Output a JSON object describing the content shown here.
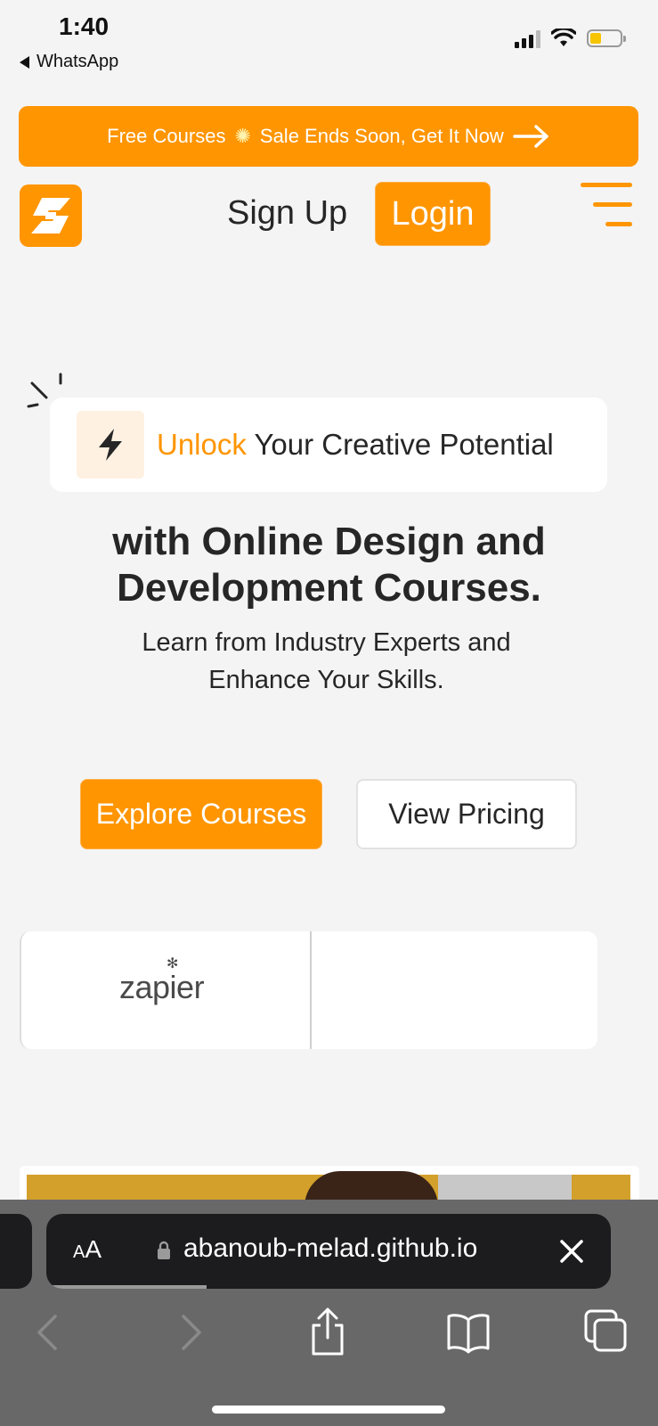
{
  "status_bar": {
    "time": "1:40",
    "back_app": "WhatsApp",
    "icons": [
      "cellular-signal-icon",
      "wifi-icon",
      "battery-icon"
    ]
  },
  "promo": {
    "text_before": "Free Courses",
    "icon": "sparkle-icon",
    "text_after": "Sale Ends Soon, Get It Now",
    "arrow_icon": "arrow-right-icon"
  },
  "header": {
    "logo_icon": "brand-s-logo",
    "signup_label": "Sign Up",
    "login_label": "Login",
    "menu_icon": "hamburger-menu-icon"
  },
  "hero": {
    "badge_icon": "lightning-bolt-icon",
    "badge_accent": "Unlock",
    "badge_text": " Your Creative Potential",
    "headline_line1": "with Online Design and",
    "headline_line2": "Development Courses.",
    "sub_line1": "Learn from Industry Experts and",
    "sub_line2": "Enhance Your Skills.",
    "explore_label": "Explore Courses",
    "pricing_label": "View Pricing"
  },
  "partners": {
    "logos": [
      "zapier"
    ]
  },
  "browser": {
    "aa_small": "A",
    "aa_large": "A",
    "url": "abanoub-melad.github.io",
    "toolbar": [
      "back-icon",
      "forward-icon",
      "share-icon",
      "bookmarks-icon",
      "tabs-icon"
    ]
  },
  "colors": {
    "accent": "#ff9500",
    "background": "#f4f4f5",
    "text": "#262626",
    "browser_chrome": "#686868"
  }
}
